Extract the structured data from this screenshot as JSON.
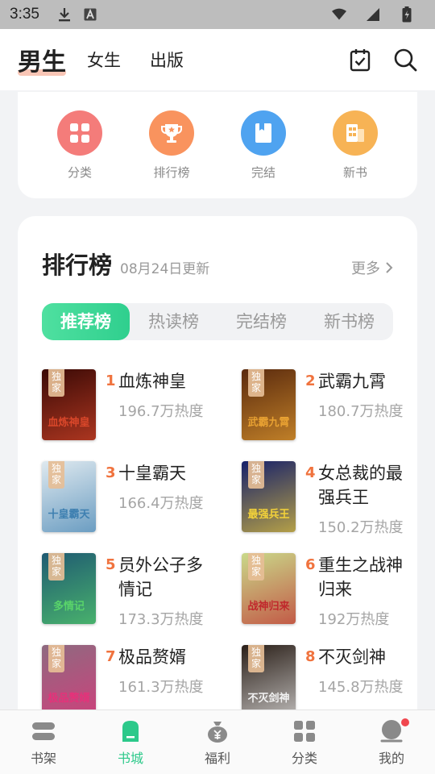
{
  "status": {
    "time": "3:35"
  },
  "header": {
    "tabs": [
      {
        "label": "男生",
        "active": true
      },
      {
        "label": "女生",
        "active": false
      },
      {
        "label": "出版",
        "active": false
      }
    ],
    "icons": [
      "checkin-icon",
      "search-icon"
    ]
  },
  "quick_links": [
    {
      "label": "分类",
      "icon": "category-grid-icon",
      "color": "#f47c7a"
    },
    {
      "label": "排行榜",
      "icon": "trophy-icon",
      "color": "#f9935e"
    },
    {
      "label": "完结",
      "icon": "bookmark-book-icon",
      "color": "#4fa3f0"
    },
    {
      "label": "新书",
      "icon": "new-book-icon",
      "color": "#f7b355"
    }
  ],
  "ranking": {
    "title": "排行榜",
    "updated": "08月24日更新",
    "more": "更多",
    "segments": [
      "推荐榜",
      "热读榜",
      "完结榜",
      "新书榜"
    ],
    "active_segment": 0,
    "badge": "独家",
    "books": [
      {
        "rank": "1",
        "name": "血炼神皇",
        "heat": "196.7万热度",
        "cover_bg": "#3a0a06",
        "cover_accent": "#d9472a",
        "cover_text": "血炼神皇"
      },
      {
        "rank": "2",
        "name": "武霸九霄",
        "heat": "180.7万热度",
        "cover_bg": "#5a2a0e",
        "cover_accent": "#e8a132",
        "cover_text": "武霸九霄"
      },
      {
        "rank": "3",
        "name": "十皇霸天",
        "heat": "166.4万热度",
        "cover_bg": "#dfe9ef",
        "cover_accent": "#3d7fb0",
        "cover_text": "十皇霸天"
      },
      {
        "rank": "4",
        "name": "女总裁的最强兵王",
        "heat": "150.2万热度",
        "cover_bg": "#16206a",
        "cover_accent": "#f3d23a",
        "cover_text": "最强兵王"
      },
      {
        "rank": "5",
        "name": "员外公子多情记",
        "heat": "173.3万热度",
        "cover_bg": "#1f5a72",
        "cover_accent": "#59d46a",
        "cover_text": "多情记"
      },
      {
        "rank": "6",
        "name": "重生之战神归来",
        "heat": "192万热度",
        "cover_bg": "#c9d98a",
        "cover_accent": "#c0282c",
        "cover_text": "战神归来"
      },
      {
        "rank": "7",
        "name": "极品赘婿",
        "heat": "161.3万热度",
        "cover_bg": "#8e6a80",
        "cover_accent": "#e5327a",
        "cover_text": "极品赘婿"
      },
      {
        "rank": "8",
        "name": "不灭剑神",
        "heat": "145.8万热度",
        "cover_bg": "#2a1f18",
        "cover_accent": "#f2f2f2",
        "cover_text": "不灭剑神"
      }
    ]
  },
  "bottom_nav": [
    {
      "label": "书架",
      "icon": "bookshelf-icon",
      "active": false
    },
    {
      "label": "书城",
      "icon": "bookstore-icon",
      "active": true
    },
    {
      "label": "福利",
      "icon": "money-bag-icon",
      "active": false
    },
    {
      "label": "分类",
      "icon": "category-icon",
      "active": false
    },
    {
      "label": "我的",
      "icon": "profile-icon",
      "active": false,
      "dot": true
    }
  ],
  "colors": {
    "accent": "#2cc98a",
    "rank_number": "#f0733e",
    "dot": "#f0474f"
  }
}
